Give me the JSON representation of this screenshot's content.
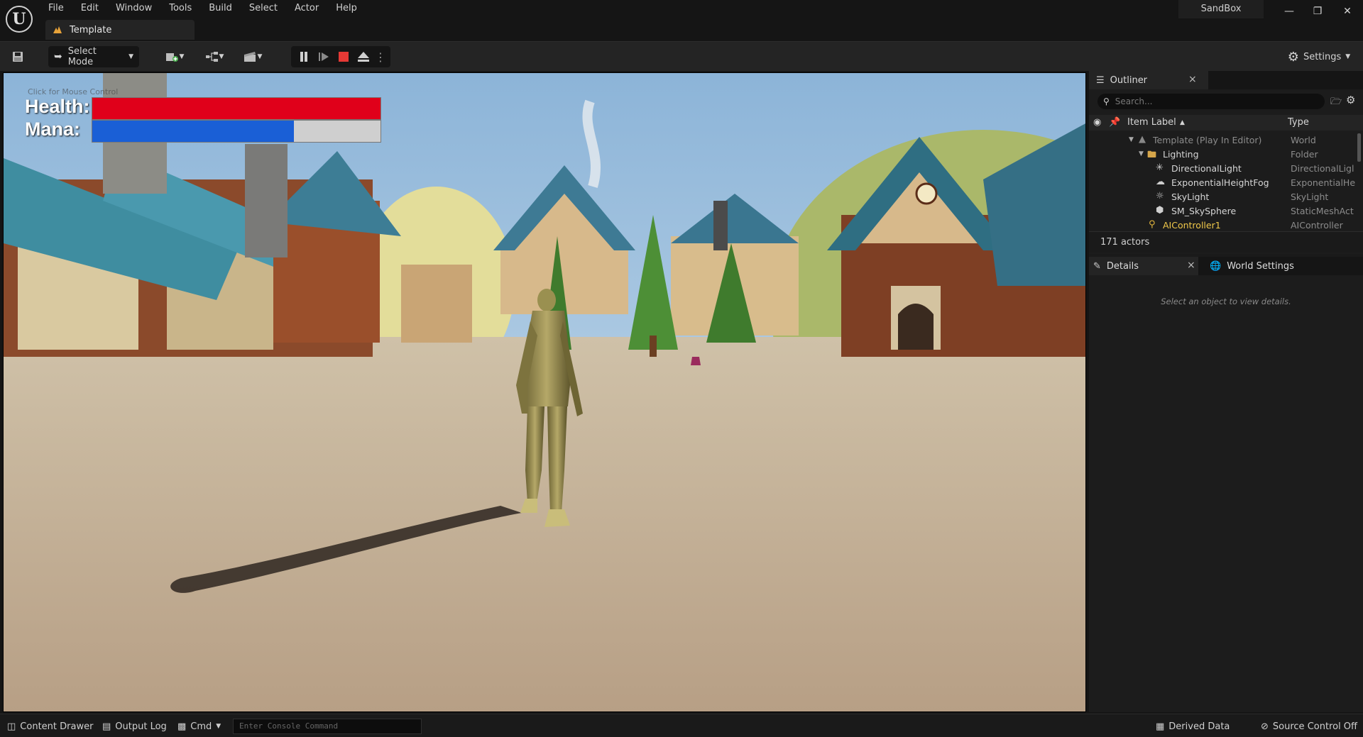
{
  "window": {
    "project_name": "SandBox",
    "menu": [
      "File",
      "Edit",
      "Window",
      "Tools",
      "Build",
      "Select",
      "Actor",
      "Help"
    ],
    "document_tab": "Template"
  },
  "toolbar": {
    "select_mode_label": "Select Mode",
    "settings_label": "Settings"
  },
  "hud": {
    "health_label": "Health:",
    "mana_label": "Mana:",
    "health_fraction": 1.0,
    "mana_fraction": 0.7,
    "health_color": "#e0001a",
    "mana_color": "#1a5fd6",
    "mouse_hint": "Click for Mouse Control"
  },
  "outliner": {
    "tab_label": "Outliner",
    "search_placeholder": "Search...",
    "col_label": "Item Label",
    "col_type": "Type",
    "rows": [
      {
        "label": "Template (Play In Editor)",
        "type": "World"
      },
      {
        "label": "Lighting",
        "type": "Folder"
      },
      {
        "label": "DirectionalLight",
        "type": "DirectionalLigl"
      },
      {
        "label": "ExponentialHeightFog",
        "type": "ExponentialHe"
      },
      {
        "label": "SkyLight",
        "type": "SkyLight"
      },
      {
        "label": "SM_SkySphere",
        "type": "StaticMeshAct"
      },
      {
        "label": "AIController1",
        "type": "AIController"
      }
    ],
    "actor_count": "171 actors"
  },
  "details": {
    "tab_label": "Details",
    "world_settings_label": "World Settings",
    "empty_text": "Select an object to view details."
  },
  "bottom": {
    "content_drawer": "Content Drawer",
    "output_log": "Output Log",
    "cmd": "Cmd",
    "console_placeholder": "Enter Console Command",
    "derived_data": "Derived Data",
    "source_control": "Source Control Off"
  }
}
